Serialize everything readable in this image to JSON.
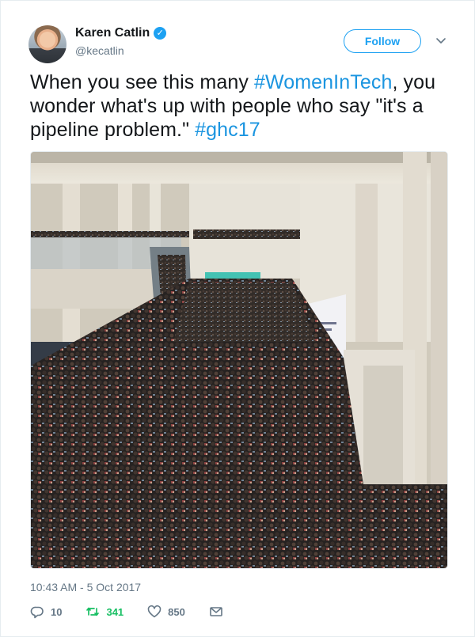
{
  "author": {
    "display_name": "Karen Catlin",
    "handle": "@kecatlin"
  },
  "follow_label": "Follow",
  "tweet": {
    "text_1": "When you see this many ",
    "hashtag_1": "#WomenInTech",
    "text_2": ", you wonder what's up with people who say \"it's a pipeline problem.\" ",
    "hashtag_2": "#ghc17"
  },
  "timestamp": "10:43 AM - 5 Oct 2017",
  "actions": {
    "replies": "10",
    "retweets": "341",
    "likes": "850"
  },
  "colors": {
    "accent": "#1da1f2",
    "hashtag": "#1b95e0",
    "retweet_active": "#17bf63",
    "muted": "#657786"
  },
  "icons": [
    "verified-badge-icon",
    "chevron-down-icon",
    "reply-icon",
    "retweet-icon",
    "like-icon",
    "direct-message-icon"
  ]
}
